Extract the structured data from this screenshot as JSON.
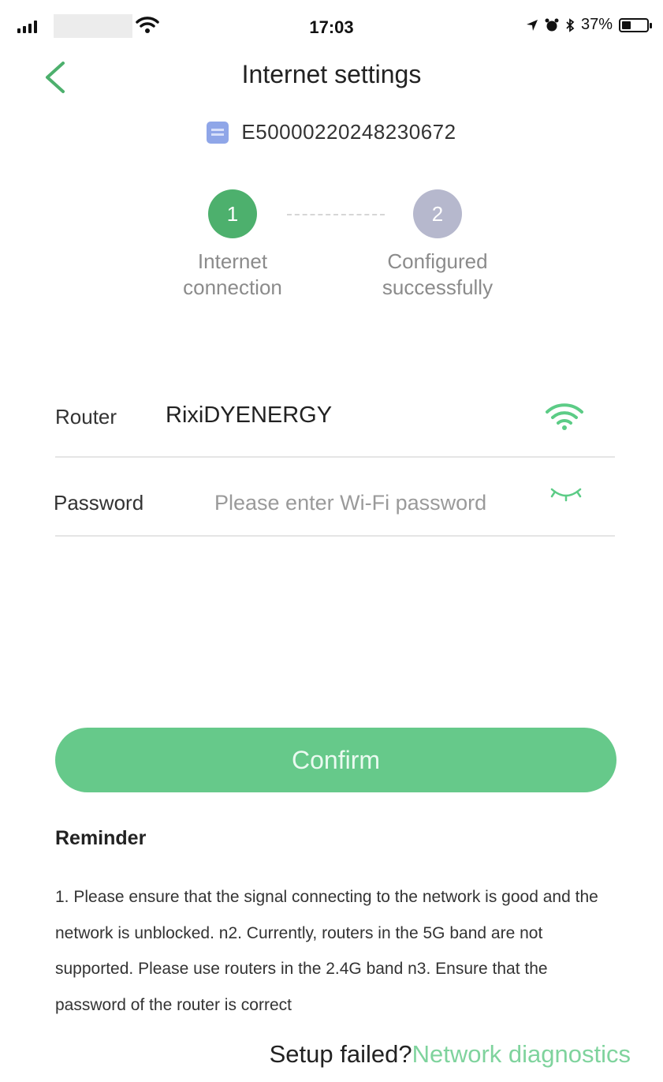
{
  "status_bar": {
    "time": "17:03",
    "battery_text": "37%",
    "battery_level": 0.37
  },
  "nav": {
    "title": "Internet settings"
  },
  "device": {
    "id": "E50000220248230672",
    "icon": "device-icon"
  },
  "steps": [
    {
      "number": "1",
      "label_line1": "Internet",
      "label_line2": "connection",
      "state": "active",
      "color": "#4db06d"
    },
    {
      "number": "2",
      "label_line1": "Configured",
      "label_line2": "successfully",
      "state": "inactive",
      "color": "#b6b8cd"
    }
  ],
  "form": {
    "router_label": "Router",
    "router_value": "RixiDYENERGY",
    "password_label": "Password",
    "password_value": "",
    "password_placeholder": "Please enter Wi-Fi password"
  },
  "confirm_label": "Confirm",
  "reminder": {
    "title": "Reminder",
    "text": "1. Please ensure that the signal connecting to the network is good and the network is unblocked. n2. Currently, routers in the 5G band are not supported. Please use routers in the 2.4G band n3. Ensure that the password of the router is correct"
  },
  "footer": {
    "prefix": "Setup failed?",
    "link": "Network diagnostics"
  },
  "colors": {
    "accent": "#4db06d",
    "button": "#66c98a",
    "link": "#7fd39d",
    "inactive_step": "#b6b8cd"
  }
}
